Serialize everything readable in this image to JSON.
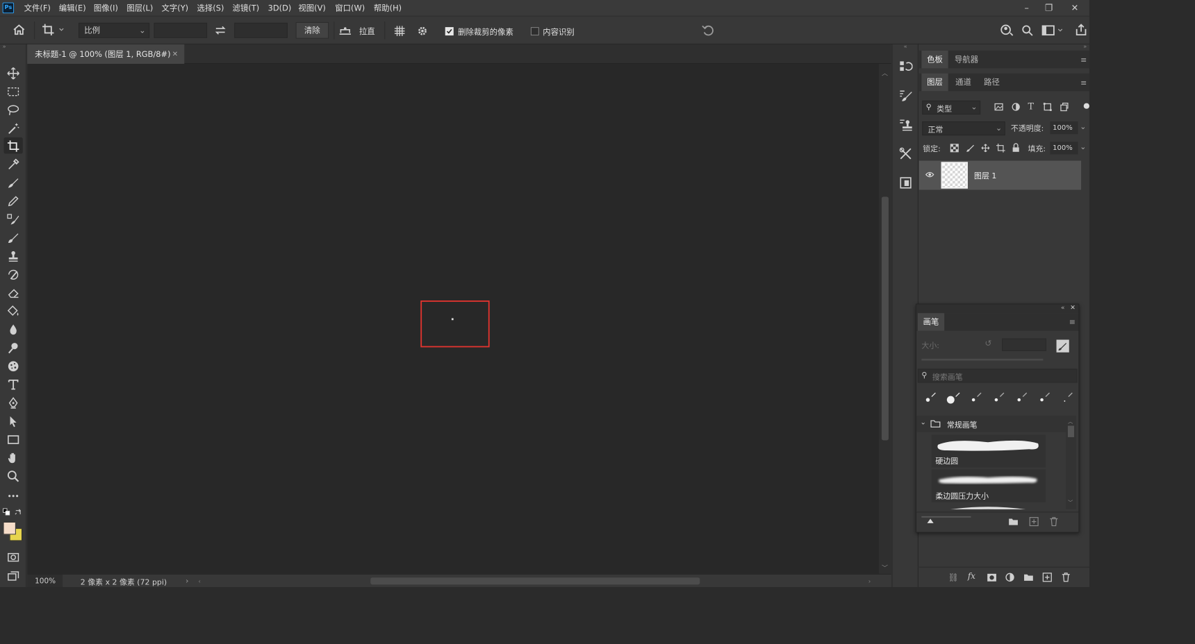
{
  "app": {
    "logo": "Ps"
  },
  "menu": [
    "文件(F)",
    "编辑(E)",
    "图像(I)",
    "图层(L)",
    "文字(Y)",
    "选择(S)",
    "滤镜(T)",
    "3D(D)",
    "视图(V)",
    "窗口(W)",
    "帮助(H)"
  ],
  "options": {
    "ratio_select": "比例",
    "ratio_width": "",
    "ratio_height": "",
    "clear_label": "清除",
    "straighten_label": "拉直",
    "delete_cropped_label": "删除裁剪的像素",
    "delete_cropped_checked": true,
    "content_aware_label": "内容识别",
    "content_aware_checked": false
  },
  "document": {
    "tab_title": "未标题-1 @ 100% (图层 1, RGB/8#)",
    "zoom": "100%",
    "info": "2 像素 x 2 像素 (72 ppi)"
  },
  "top_panel_tabs": [
    "色板",
    "导航器"
  ],
  "layers_panel": {
    "tabs": [
      "图层",
      "通道",
      "路径"
    ],
    "filter_kind": "类型",
    "blend_mode": "正常",
    "opacity_label": "不透明度:",
    "opacity_value": "100%",
    "lock_label": "锁定:",
    "fill_label": "填充:",
    "fill_value": "100%",
    "layers": [
      {
        "name": "图层 1",
        "visible": true
      }
    ]
  },
  "brushes_panel": {
    "title": "画笔",
    "size_label": "大小:",
    "search_placeholder": "搜索画笔",
    "group_name": "常规画笔",
    "brushes": [
      "硬边圆",
      "柔边圆压力大小"
    ]
  },
  "colors": {
    "foreground": "#f5dcc8",
    "background": "#e7d54e",
    "selection_box": "#e3342f",
    "accent": "#31a8ff"
  }
}
